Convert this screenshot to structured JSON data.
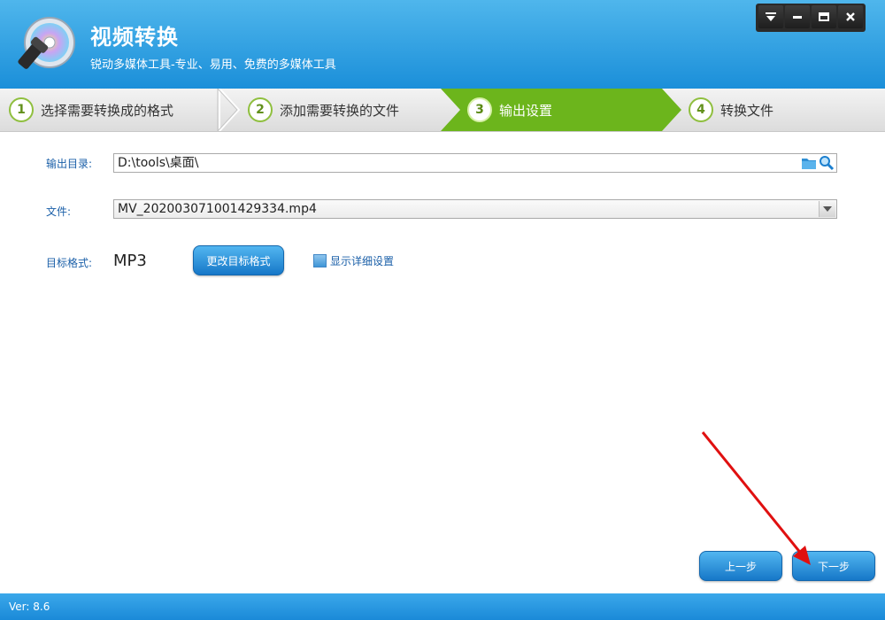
{
  "app": {
    "title": "视频转换",
    "subtitle": "锐动多媒体工具-专业、易用、免费的多媒体工具"
  },
  "window_controls": [
    "menu-icon",
    "minimize-icon",
    "maximize-icon",
    "close-icon"
  ],
  "steps": [
    {
      "num": "1",
      "label": "选择需要转换成的格式",
      "active": false
    },
    {
      "num": "2",
      "label": "添加需要转换的文件",
      "active": false
    },
    {
      "num": "3",
      "label": "输出设置",
      "active": true
    },
    {
      "num": "4",
      "label": "转换文件",
      "active": false
    }
  ],
  "form": {
    "output_dir_label": "输出目录:",
    "output_dir_value": "D:\\tools\\桌面\\",
    "file_label": "文件:",
    "file_value": "MV_202003071001429334.mp4",
    "format_label": "目标格式:",
    "format_value": "MP3",
    "change_format_button": "更改目标格式",
    "show_details_label": "显示详细设置"
  },
  "nav": {
    "prev_button": "上一步",
    "next_button": "下一步"
  },
  "footer": {
    "version": "Ver: 8.6"
  },
  "colors": {
    "header": "#1b8fd9",
    "active_step": "#6cb51c",
    "annotation_arrow": "#e01010"
  }
}
